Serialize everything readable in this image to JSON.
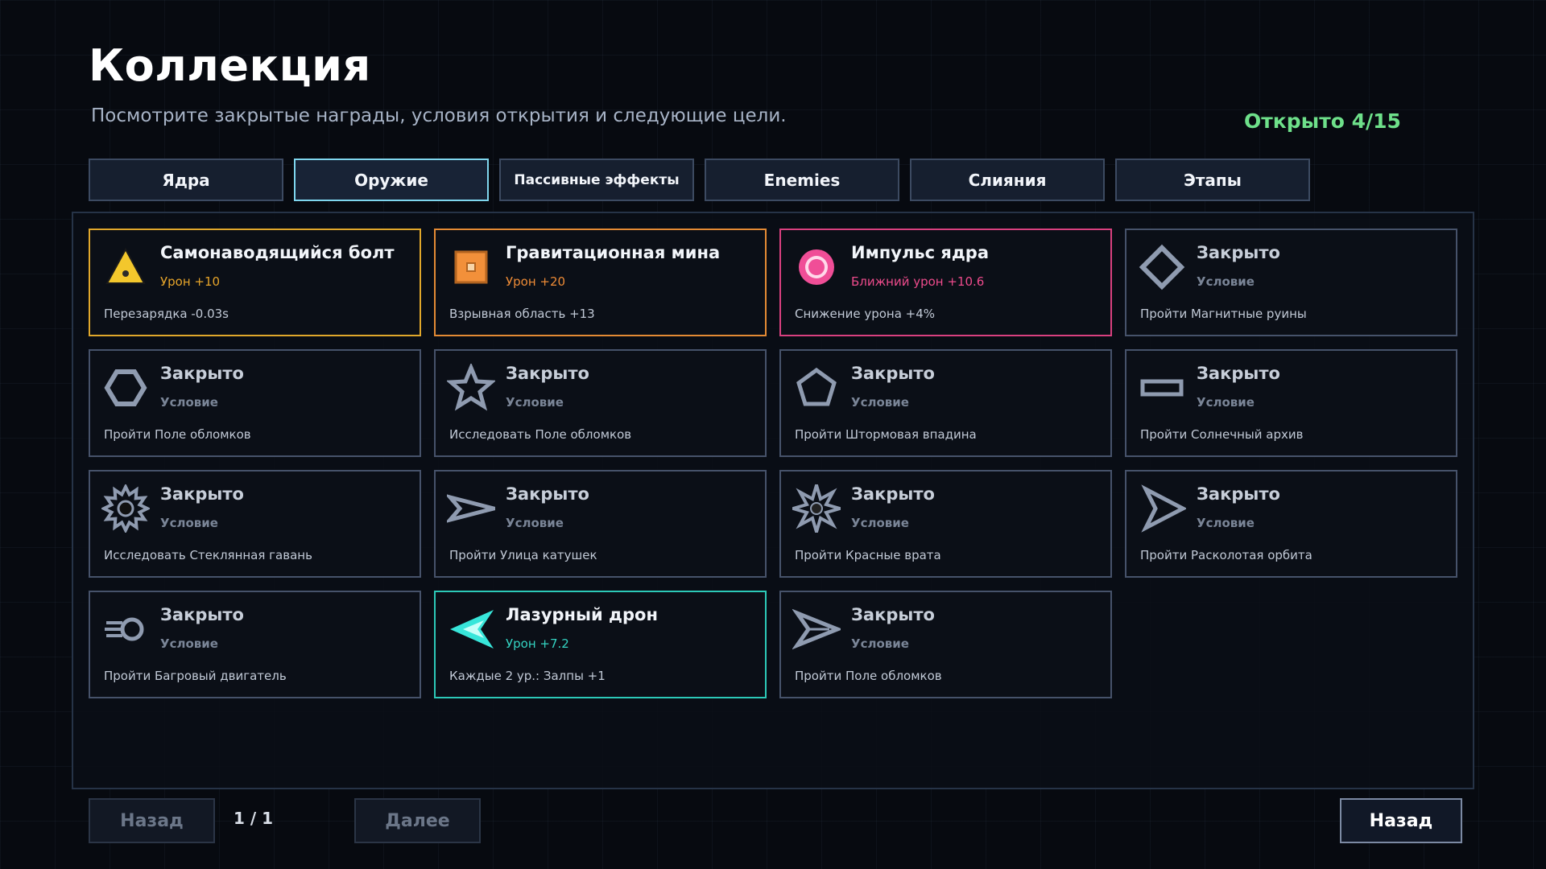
{
  "header": {
    "title": "Коллекция",
    "subtitle": "Посмотрите закрытые награды, условия открытия и следующие цели.",
    "progress": "Открыто 4/15",
    "progress_color": "#6ee08a"
  },
  "tabs": [
    {
      "label": "Ядра"
    },
    {
      "label": "Оружие",
      "active": true
    },
    {
      "label": "Пассивные эффекты"
    },
    {
      "label": "Enemies"
    },
    {
      "label": "Слияния"
    },
    {
      "label": "Этапы"
    }
  ],
  "cards": [
    {
      "icon": "triangle-icon",
      "name": "Самонаводящийся болт",
      "stat": "Урон +10",
      "desc": "Перезарядка -0.03s",
      "border": "#e0a72b",
      "stat_color": "#e7a52a",
      "color": "#f3c72c",
      "locked": false
    },
    {
      "icon": "square-mine-icon",
      "name": "Гравитационная мина",
      "stat": "Урон +20",
      "desc": "Взрывная область +13",
      "border": "#e48a34",
      "stat_color": "#ee8b36",
      "color": "#f2903a",
      "locked": false
    },
    {
      "icon": "ring-icon",
      "name": "Импульс ядра",
      "stat": "Ближний урон +10.6",
      "desc": "Снижение урона +4%",
      "border": "#d9407f",
      "stat_color": "#ee4b8c",
      "color": "#f04e97",
      "locked": false
    },
    {
      "icon": "diamond-icon",
      "name": "Закрыто",
      "stat": "Условие",
      "desc": "Пройти Магнитные руины",
      "locked": true
    },
    {
      "icon": "hexagon-icon",
      "name": "Закрыто",
      "stat": "Условие",
      "desc": "Пройти Поле обломков",
      "locked": true
    },
    {
      "icon": "star-icon",
      "name": "Закрыто",
      "stat": "Условие",
      "desc": "Исследовать Поле обломков",
      "locked": true
    },
    {
      "icon": "pentagon-icon",
      "name": "Закрыто",
      "stat": "Условие",
      "desc": "Пройти Штормовая впадина",
      "locked": true
    },
    {
      "icon": "bar-icon",
      "name": "Закрыто",
      "stat": "Условие",
      "desc": "Пройти Солнечный архив",
      "locked": true
    },
    {
      "icon": "gear-icon",
      "name": "Закрыто",
      "stat": "Условие",
      "desc": "Исследовать Стеклянная гавань",
      "locked": true
    },
    {
      "icon": "dart-icon",
      "name": "Закрыто",
      "stat": "Условие",
      "desc": "Пройти Улица катушек",
      "locked": true
    },
    {
      "icon": "starburst-icon",
      "name": "Закрыто",
      "stat": "Условие",
      "desc": "Пройти Красные врата",
      "locked": true
    },
    {
      "icon": "arrowhead-icon",
      "name": "Закрыто",
      "stat": "Условие",
      "desc": "Пройти Расколотая орбита",
      "locked": true
    },
    {
      "icon": "engine-icon",
      "name": "Закрыто",
      "stat": "Условие",
      "desc": "Пройти Багровый двигатель",
      "locked": true
    },
    {
      "icon": "drone-icon",
      "name": "Лазурный дрон",
      "stat": "Урон +7.2",
      "desc": "Каждые 2 ур.: Залпы +1",
      "border": "#2cc9b8",
      "stat_color": "#34d3c2",
      "color": "#38e6da",
      "locked": false
    },
    {
      "icon": "chevron-ship-icon",
      "name": "Закрыто",
      "stat": "Условие",
      "desc": "Пройти Поле обломков",
      "locked": true
    }
  ],
  "locked_style": {
    "border": "#46526a",
    "stat_color": "#7a8597",
    "color": "#8f9bb0"
  },
  "pagination": {
    "prev_label": "Назад",
    "page": "1 / 1",
    "next_label": "Далее"
  },
  "back_label": "Назад"
}
